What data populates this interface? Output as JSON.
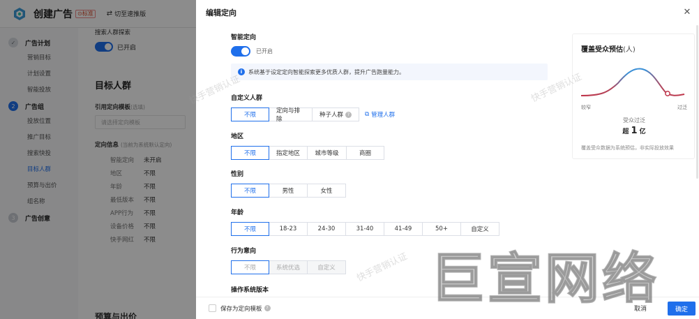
{
  "header": {
    "title": "创建广告",
    "tag": "标准",
    "switch_label": "切至速推版"
  },
  "sidebar": {
    "steps": [
      {
        "num": "✓",
        "title": "广告计划",
        "items": [
          "营销目标",
          "计划设置",
          "智能投放"
        ]
      },
      {
        "num": "2",
        "title": "广告组",
        "items": [
          "投放位置",
          "推广目标",
          "搜索快投",
          "目标人群",
          "预算与出价",
          "组名称"
        ]
      },
      {
        "num": "3",
        "title": "广告创意",
        "items": []
      }
    ],
    "active_item": "目标人群"
  },
  "bg_content": {
    "top_label": "搜索人群探索",
    "top_toggle": "已开启",
    "section_title": "目标人群",
    "template_label": "引用定向模板",
    "template_hint": "(选填)",
    "template_placeholder": "请选择定向模板",
    "info_label": "定向信息",
    "info_hint": "(当前为系统默认定向)",
    "rows": [
      {
        "k": "智能定向",
        "v": "未开启"
      },
      {
        "k": "地区",
        "v": "不限"
      },
      {
        "k": "年龄",
        "v": "不限"
      },
      {
        "k": "最低版本",
        "v": "不限"
      },
      {
        "k": "APP行为",
        "v": "不限"
      },
      {
        "k": "设备价格",
        "v": "不限"
      },
      {
        "k": "快手网红",
        "v": "不限"
      }
    ],
    "bottom_title": "预算与出价"
  },
  "drawer": {
    "title": "编辑定向",
    "smart": {
      "label": "智能定向",
      "state": "已开启",
      "info": "系统基于设定定向智能探索更多优质人群，提升广告跑量能力。"
    },
    "custom_audience": {
      "label": "自定义人群",
      "options": [
        "不限",
        "定向与排除",
        "种子人群"
      ],
      "selected": 0,
      "manage_link": "管理人群"
    },
    "region": {
      "label": "地区",
      "options": [
        "不限",
        "指定地区",
        "城市等级",
        "商圈"
      ],
      "selected": 0
    },
    "gender": {
      "label": "性别",
      "options": [
        "不限",
        "男性",
        "女性"
      ],
      "selected": 0
    },
    "age": {
      "label": "年龄",
      "options": [
        "不限",
        "18-23",
        "24-30",
        "31-40",
        "41-49",
        "50+",
        "自定义"
      ],
      "selected": 0
    },
    "behavior": {
      "label": "行为意向",
      "options": [
        "不限",
        "系统优选",
        "自定义"
      ],
      "selected": 0
    },
    "os_version": {
      "label": "操作系统版本"
    },
    "footer": {
      "save_template": "保存为定向模板",
      "cancel": "取消",
      "confirm": "确定"
    }
  },
  "estimate": {
    "title": "覆盖受众预估",
    "unit": "(人)",
    "left_axis": "较窄",
    "right_axis": "过泛",
    "audience_label": "受众过泛",
    "value_prefix": "超",
    "value_num": "1",
    "value_unit": "亿",
    "note": "覆盖受众数据为系统预估，非实际投放效果"
  },
  "watermarks": {
    "text1": "快手营销认证",
    "text2": "快手营销认证",
    "text3": "快手营销认证",
    "brand": "巨宣网络"
  },
  "colors": {
    "accent": "#1f6feb",
    "curve_red": "#c0354a",
    "curve_blue": "#3a8fd6"
  }
}
